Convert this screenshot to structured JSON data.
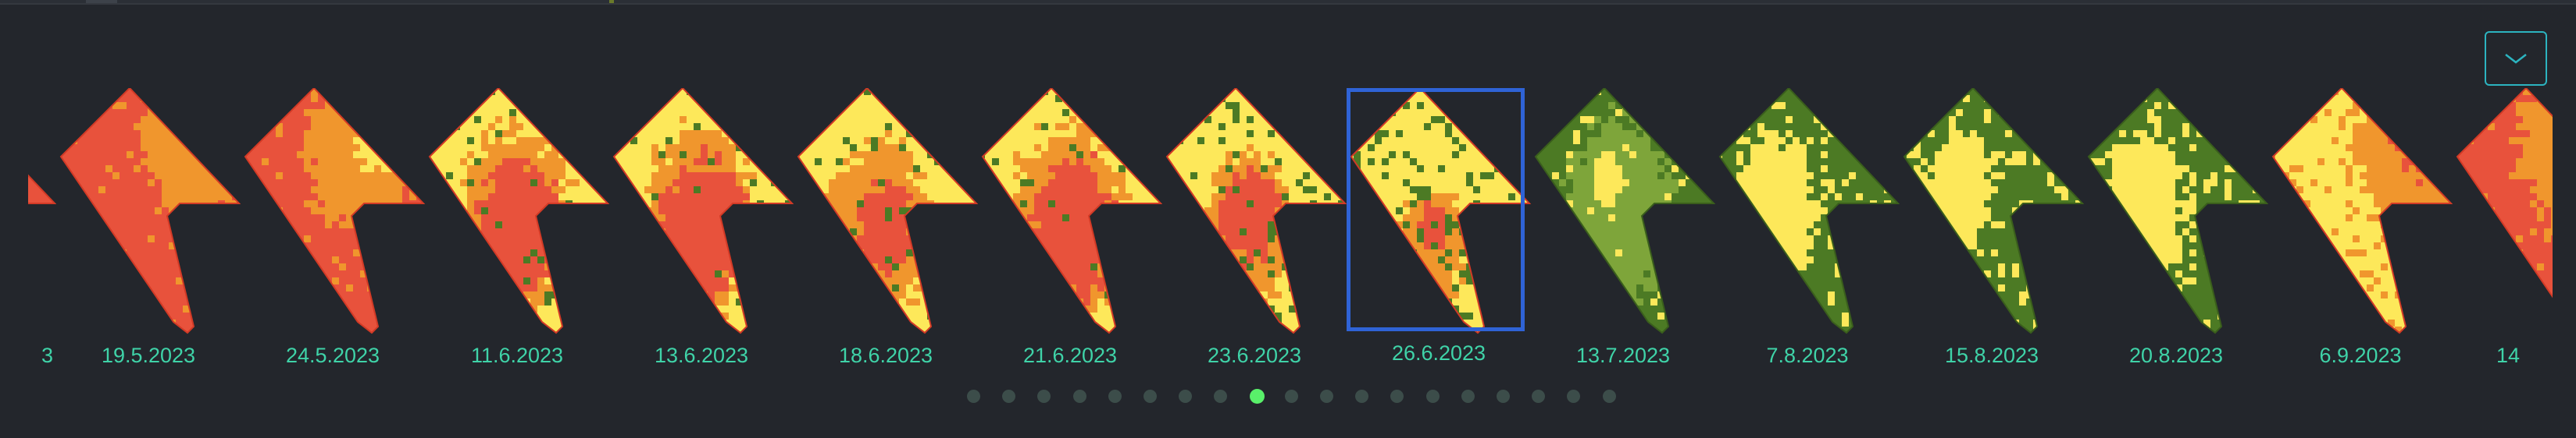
{
  "palette": {
    "red": "#e8523c",
    "orange": "#f0962d",
    "yellow": "#fde85a",
    "lightgreen": "#7ea53a",
    "green": "#4c7a24",
    "accent_date": "#3fd3a8",
    "selection": "#2f63d6",
    "dot_active": "#59f06a",
    "dot_inactive": "#3c4d4a",
    "button_border": "#2cb4c0"
  },
  "thumbnails": [
    {
      "date": "3",
      "scheme": "red_full",
      "partial": "left"
    },
    {
      "date": "19.5.2023",
      "scheme": "red_mostly"
    },
    {
      "date": "24.5.2023",
      "scheme": "red_orange"
    },
    {
      "date": "11.6.2023",
      "scheme": "yellow_red"
    },
    {
      "date": "13.6.2023",
      "scheme": "yellow_red"
    },
    {
      "date": "18.6.2023",
      "scheme": "yellow_orange"
    },
    {
      "date": "21.6.2023",
      "scheme": "yellow_red"
    },
    {
      "date": "23.6.2023",
      "scheme": "yellow_mixed"
    },
    {
      "date": "26.6.2023",
      "scheme": "yellow_green",
      "selected": true
    },
    {
      "date": "13.7.2023",
      "scheme": "green_full"
    },
    {
      "date": "7.8.2023",
      "scheme": "green_yellow"
    },
    {
      "date": "15.8.2023",
      "scheme": "green_mixed"
    },
    {
      "date": "20.8.2023",
      "scheme": "green_yellow"
    },
    {
      "date": "6.9.2023",
      "scheme": "yellow_orange_red"
    },
    {
      "date": "14",
      "scheme": "red_orange",
      "partial": "right"
    }
  ],
  "pagination": {
    "count": 19,
    "active_index": 8
  },
  "collapse_button": {
    "icon": "chevron-down-icon"
  }
}
